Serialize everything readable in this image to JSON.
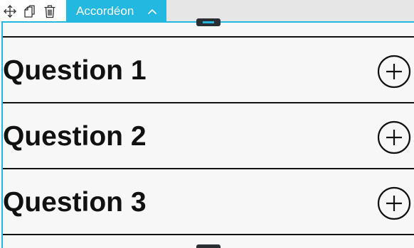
{
  "toolbar": {
    "icons": [
      "move-icon",
      "duplicate-icon",
      "trash-icon"
    ],
    "widget_label": "Accordéon"
  },
  "accordion": {
    "items": [
      {
        "title": "Question 1"
      },
      {
        "title": "Question 2"
      },
      {
        "title": "Question 3"
      }
    ]
  },
  "colors": {
    "accent": "#22b8e0",
    "text": "#111111",
    "background": "#f7f7f7",
    "handle": "#2a2f34"
  }
}
